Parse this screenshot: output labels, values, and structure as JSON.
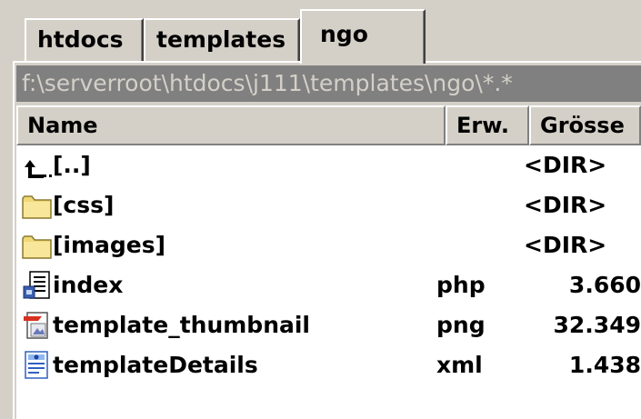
{
  "tabs": [
    {
      "label": "htdocs",
      "active": false
    },
    {
      "label": "templates",
      "active": false
    },
    {
      "label": "ngo",
      "active": true
    }
  ],
  "path": "f:\\serverroot\\htdocs\\j111\\templates\\ngo\\*.*",
  "columns": {
    "name": "Name",
    "ext": "Erw.",
    "size": "Grösse"
  },
  "files": [
    {
      "icon": "parent-dir-icon",
      "name": "[..]",
      "ext": "",
      "size": "<DIR>"
    },
    {
      "icon": "folder-icon",
      "name": "[css]",
      "ext": "",
      "size": "<DIR>"
    },
    {
      "icon": "folder-icon",
      "name": "[images]",
      "ext": "",
      "size": "<DIR>"
    },
    {
      "icon": "php-file-icon",
      "name": "index",
      "ext": "php",
      "size": "3.660"
    },
    {
      "icon": "png-file-icon",
      "name": "template_thumbnail",
      "ext": "png",
      "size": "32.349"
    },
    {
      "icon": "xml-file-icon",
      "name": "templateDetails",
      "ext": "xml",
      "size": "1.438"
    }
  ],
  "colors": {
    "window_bg": "#d4d0c8",
    "path_bar_bg": "#808080",
    "list_bg": "#ffffff",
    "folder_yellow": "#f0d878"
  }
}
